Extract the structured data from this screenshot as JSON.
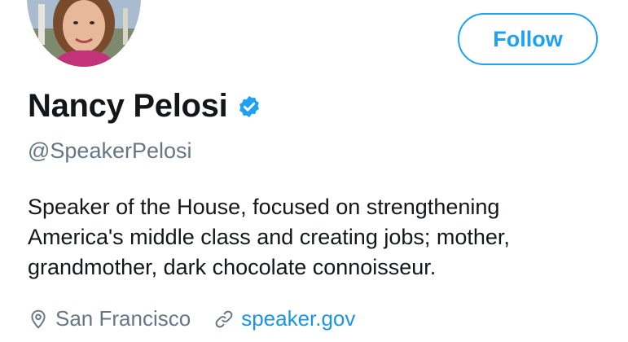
{
  "profile": {
    "display_name": "Nancy Pelosi",
    "handle": "@SpeakerPelosi",
    "verified": true,
    "bio_lines": [
      "Speaker of the House, focused on strengthening",
      "America's middle class and creating jobs; mother,",
      "grandmother, dark chocolate connoisseur."
    ],
    "location": "San Francisco",
    "website": "speaker.gov"
  },
  "actions": {
    "follow_label": "Follow"
  },
  "icons": {
    "verified": "verified-badge-icon",
    "location": "location-pin-icon",
    "website": "link-icon"
  },
  "colors": {
    "accent": "#1da1f2",
    "link": "#1b95e0",
    "text": "#14171a",
    "secondary_text": "#657786"
  }
}
